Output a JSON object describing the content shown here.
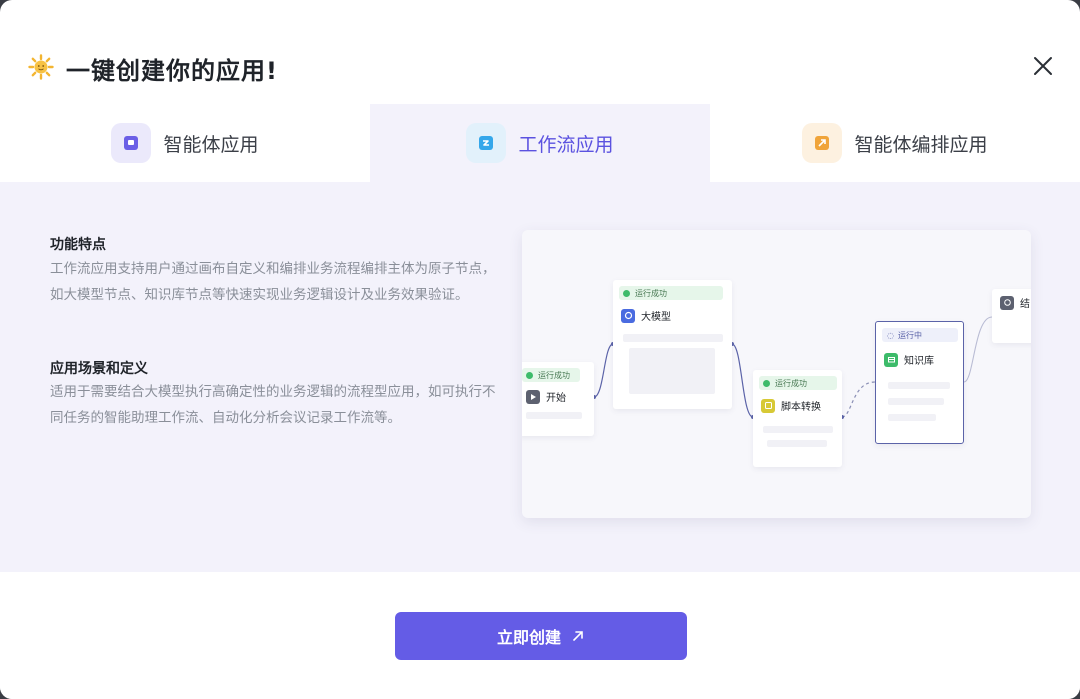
{
  "dialog": {
    "title": "一键创建你的应用!",
    "title_icon": "sun-emoji-icon",
    "close_icon": "close-icon"
  },
  "tabs": [
    {
      "label": "智能体应用",
      "icon": "agent-app-icon",
      "color": "#6b5fe6",
      "active": false
    },
    {
      "label": "工作流应用",
      "icon": "workflow-app-icon",
      "color": "#35a7ea",
      "active": true
    },
    {
      "label": "智能体编排应用",
      "icon": "agent-orchestration-icon",
      "color": "#f0a43a",
      "active": false
    }
  ],
  "features": {
    "title": "功能特点",
    "text": "工作流应用支持用户通过画布自定义和编排业务流程编排主体为原子节点，如大模型节点、知识库节点等快速实现业务逻辑设计及业务效果验证。"
  },
  "scenarios": {
    "title": "应用场景和定义",
    "text": "适用于需要结合大模型执行高确定性的业务逻辑的流程型应用，如可执行不同任务的智能助理工作流、自动化分析会议记录工作流等。"
  },
  "workflow_preview": {
    "nodes": [
      {
        "status": "运行成功",
        "title": "开始"
      },
      {
        "status": "运行成功",
        "title": "大模型"
      },
      {
        "status": "运行成功",
        "title": "脚本转换"
      },
      {
        "status": "运行中",
        "title": "知识库"
      },
      {
        "status": "",
        "title": "结"
      }
    ]
  },
  "footer": {
    "create_label": "立即创建",
    "create_icon": "arrow-up-right-icon"
  },
  "colors": {
    "accent": "#645ce6",
    "panel_bg": "#f3f2fb",
    "success": "#3dbb6a"
  }
}
